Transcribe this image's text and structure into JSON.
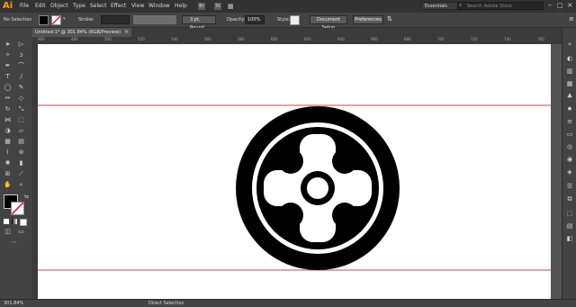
{
  "app": {
    "logo": "Ai"
  },
  "menu": [
    "File",
    "Edit",
    "Object",
    "Type",
    "Select",
    "Effect",
    "View",
    "Window",
    "Help"
  ],
  "workspace": {
    "label": "Essentials"
  },
  "search": {
    "placeholder": "Search Adobe Stock"
  },
  "control_bar": {
    "selection": "No Selection",
    "stroke_label": "Stroke:",
    "brush": "3 pt. Round",
    "opacity_label": "Opacity:",
    "opacity_value": "100%",
    "style_label": "Style:",
    "document_setup": "Document Setup",
    "preferences": "Preferences"
  },
  "document_tab": {
    "title": "Untitled-1* @ 301.84% (RGB/Preview)"
  },
  "ruler": {
    "ticks": [
      "460",
      "480",
      "500",
      "520",
      "540",
      "560",
      "580",
      "600",
      "620",
      "640",
      "660",
      "680",
      "700",
      "720",
      "740",
      "760"
    ]
  },
  "statusbar": {
    "zoom": "301.84%",
    "tool": "Direct Selection"
  },
  "colors": {
    "guide": "#c44a4a",
    "artwork": "#000000",
    "canvas": "#ffffff",
    "accent": "#ff9a00"
  }
}
